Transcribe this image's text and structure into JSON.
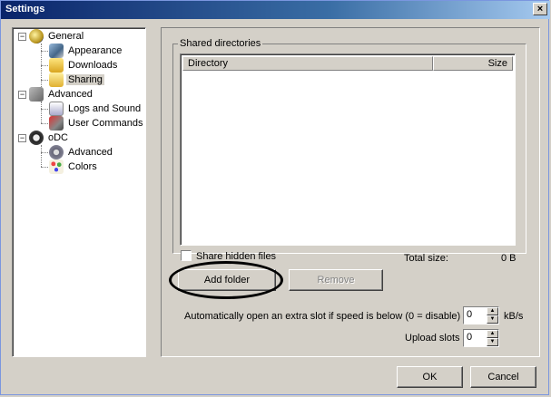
{
  "window": {
    "title": "Settings",
    "close_glyph": "×"
  },
  "tree": {
    "expander_minus": "−",
    "items": [
      {
        "label": "General",
        "icon": "general-globe-icon"
      },
      {
        "label": "Appearance",
        "icon": "appearance-icon"
      },
      {
        "label": "Downloads",
        "icon": "downloads-folder-icon"
      },
      {
        "label": "Sharing",
        "icon": "sharing-folder-icon",
        "selected": true
      },
      {
        "label": "Advanced",
        "icon": "advanced-icon"
      },
      {
        "label": "Logs and Sound",
        "icon": "logs-sound-icon"
      },
      {
        "label": "User Commands",
        "icon": "user-commands-icon"
      },
      {
        "label": "oDC",
        "icon": "odc-icon"
      },
      {
        "label": "Advanced",
        "icon": "gear-icon"
      },
      {
        "label": "Colors",
        "icon": "colors-icon"
      }
    ]
  },
  "shared": {
    "group_label": "Shared directories",
    "columns": [
      "Directory",
      "Size"
    ],
    "rows": [],
    "share_hidden_label": "Share hidden files",
    "share_hidden_checked": false,
    "total_size_label": "Total size:",
    "total_size_value": "0 B",
    "add_folder": "Add folder",
    "remove": "Remove"
  },
  "slots": {
    "auto_open_label": "Automatically open an extra slot if speed is below (0 = disable)",
    "auto_open_value": "0",
    "auto_open_unit": "kB/s",
    "upload_slots_label": "Upload slots",
    "upload_slots_value": "0"
  },
  "footer": {
    "ok": "OK",
    "cancel": "Cancel"
  },
  "colors": {
    "titlebar_start": "#0a246a",
    "face": "#d4d0c8",
    "highlight_ring": "#000000"
  }
}
